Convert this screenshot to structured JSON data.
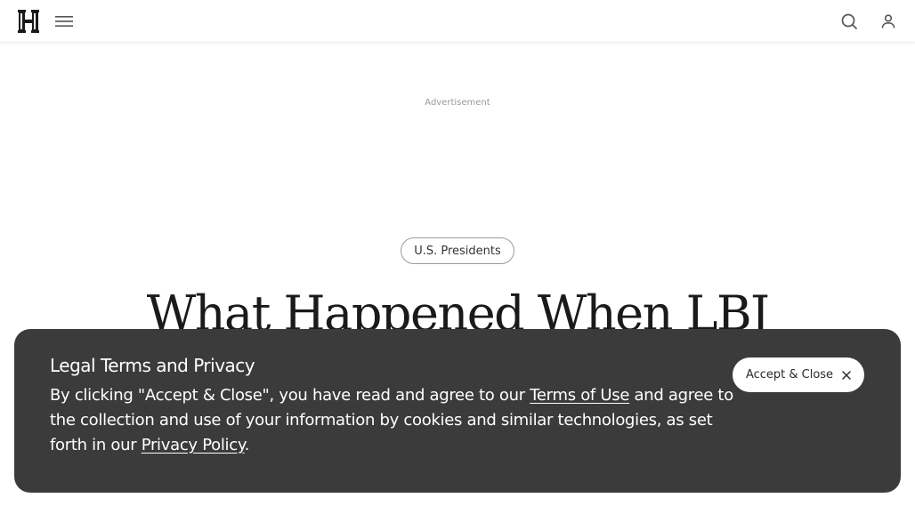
{
  "header": {
    "logo_letter": "H",
    "menu_icon": "hamburger-menu-icon",
    "search_icon": "search-icon",
    "user_icon": "user-icon"
  },
  "ad": {
    "label": "Advertisement"
  },
  "article": {
    "category": "U.S. Presidents",
    "headline": "What Happened When LBJ"
  },
  "consent": {
    "title": "Legal Terms and Privacy",
    "body_part1": "By clicking \"Accept & Close\", you have read and agree to our ",
    "terms_link": "Terms of Use",
    "body_part2": " and agree to the collection and use of your information by cookies and similar technologies, as set forth in our ",
    "privacy_link": "Privacy Policy",
    "body_part3": ".",
    "accept_label": "Accept & Close",
    "accept_icon": "close-icon"
  },
  "colors": {
    "consent_bg": "#3b3b3b",
    "text_dark": "#1a1a1a",
    "muted": "#9a9a9a"
  }
}
